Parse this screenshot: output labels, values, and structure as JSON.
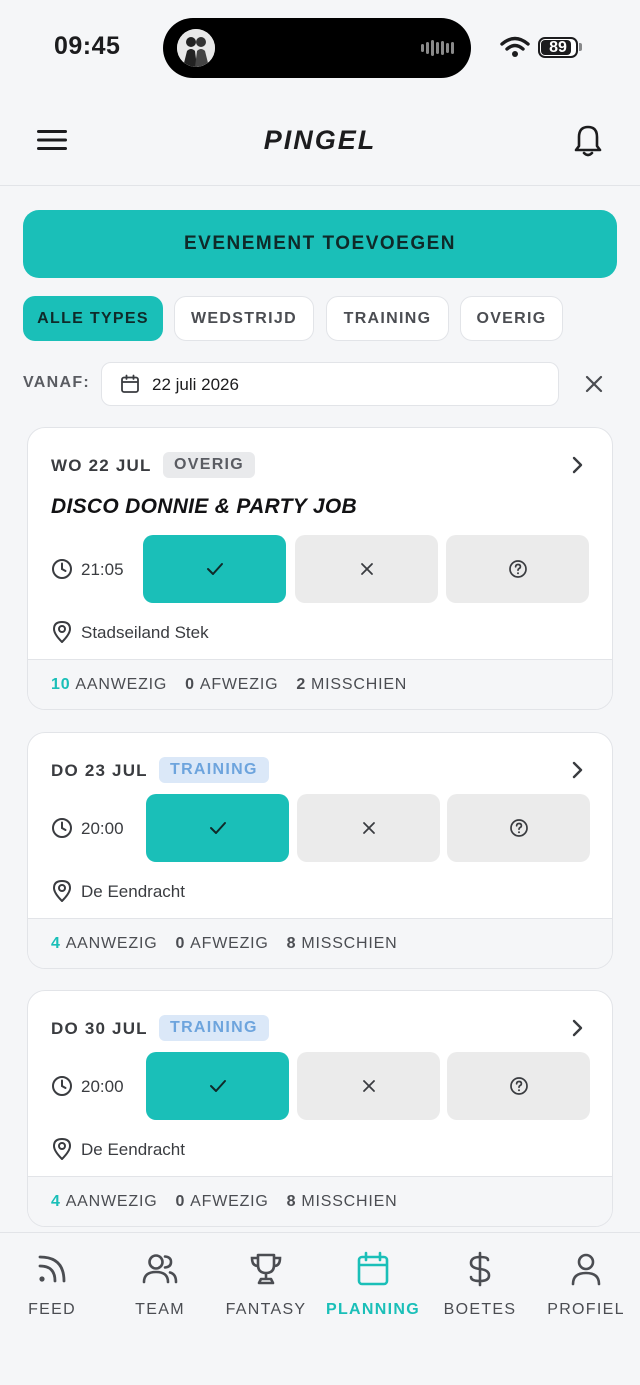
{
  "status_bar": {
    "time": "09:45",
    "battery_level": "89",
    "battery_fraction": 0.89
  },
  "header": {
    "title": "PINGEL"
  },
  "actions": {
    "add_event": "EVENEMENT TOEVOEGEN"
  },
  "filters": {
    "types": [
      {
        "label": "ALLE TYPES",
        "active": true
      },
      {
        "label": "WEDSTRIJD",
        "active": false
      },
      {
        "label": "TRAINING",
        "active": false
      },
      {
        "label": "OVERIG",
        "active": false
      }
    ],
    "from_label": "VANAF:",
    "from_date": "22 juli 2026"
  },
  "events": [
    {
      "date": "WO 22 JUL",
      "type": "OVERIG",
      "title": "DISCO DONNIE & PARTY JOB",
      "time": "21:05",
      "location": "Stadseiland Stek",
      "selected_response": "yes",
      "stats": {
        "present_count": "10",
        "present_label": "AANWEZIG",
        "absent_count": "0",
        "absent_label": "AFWEZIG",
        "maybe_count": "2",
        "maybe_label": "MISSCHIEN"
      }
    },
    {
      "date": "DO 23 JUL",
      "type": "TRAINING",
      "title": "",
      "time": "20:00",
      "location": "De Eendracht",
      "selected_response": "yes",
      "stats": {
        "present_count": "4",
        "present_label": "AANWEZIG",
        "absent_count": "0",
        "absent_label": "AFWEZIG",
        "maybe_count": "8",
        "maybe_label": "MISSCHIEN"
      }
    },
    {
      "date": "DO 30 JUL",
      "type": "TRAINING",
      "title": "",
      "time": "20:00",
      "location": "De Eendracht",
      "selected_response": "yes",
      "stats": {
        "present_count": "4",
        "present_label": "AANWEZIG",
        "absent_count": "0",
        "absent_label": "AFWEZIG",
        "maybe_count": "8",
        "maybe_label": "MISSCHIEN"
      }
    }
  ],
  "tabbar": {
    "items": [
      {
        "label": "FEED",
        "icon": "rss-icon",
        "active": false
      },
      {
        "label": "TEAM",
        "icon": "users-icon",
        "active": false
      },
      {
        "label": "FANTASY",
        "icon": "trophy-icon",
        "active": false
      },
      {
        "label": "PLANNING",
        "icon": "calendar-icon",
        "active": true
      },
      {
        "label": "BOETES",
        "icon": "dollar-icon",
        "active": false
      },
      {
        "label": "PROFIEL",
        "icon": "user-icon",
        "active": false
      }
    ]
  },
  "colors": {
    "accent": "#1abfb8",
    "training_badge_bg": "#dbe8f8",
    "training_badge_text": "#6da4dd",
    "overig_badge_bg": "#e9eaec"
  }
}
